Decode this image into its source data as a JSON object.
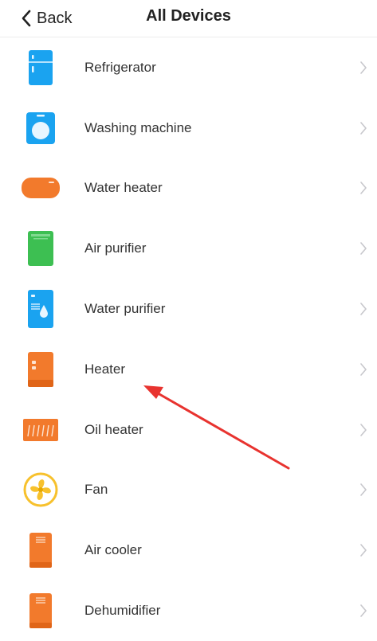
{
  "nav": {
    "back_label": "Back",
    "title": "All Devices"
  },
  "colors": {
    "blue": "#1aa3f0",
    "orange": "#f27a2c",
    "green": "#3dbf52",
    "yellow": "#f7c12d",
    "annotation_red": "#e8332f"
  },
  "devices": [
    {
      "label": "Refrigerator",
      "icon": "refrigerator-icon"
    },
    {
      "label": "Washing machine",
      "icon": "washing-machine-icon"
    },
    {
      "label": "Water heater",
      "icon": "water-heater-icon"
    },
    {
      "label": "Air purifier",
      "icon": "air-purifier-icon"
    },
    {
      "label": "Water purifier",
      "icon": "water-purifier-icon"
    },
    {
      "label": "Heater",
      "icon": "heater-icon"
    },
    {
      "label": "Oil heater",
      "icon": "oil-heater-icon"
    },
    {
      "label": "Fan",
      "icon": "fan-icon"
    },
    {
      "label": "Air cooler",
      "icon": "air-cooler-icon"
    },
    {
      "label": "Dehumidifier",
      "icon": "dehumidifier-icon"
    }
  ],
  "annotation": {
    "points_to": "Heater"
  }
}
